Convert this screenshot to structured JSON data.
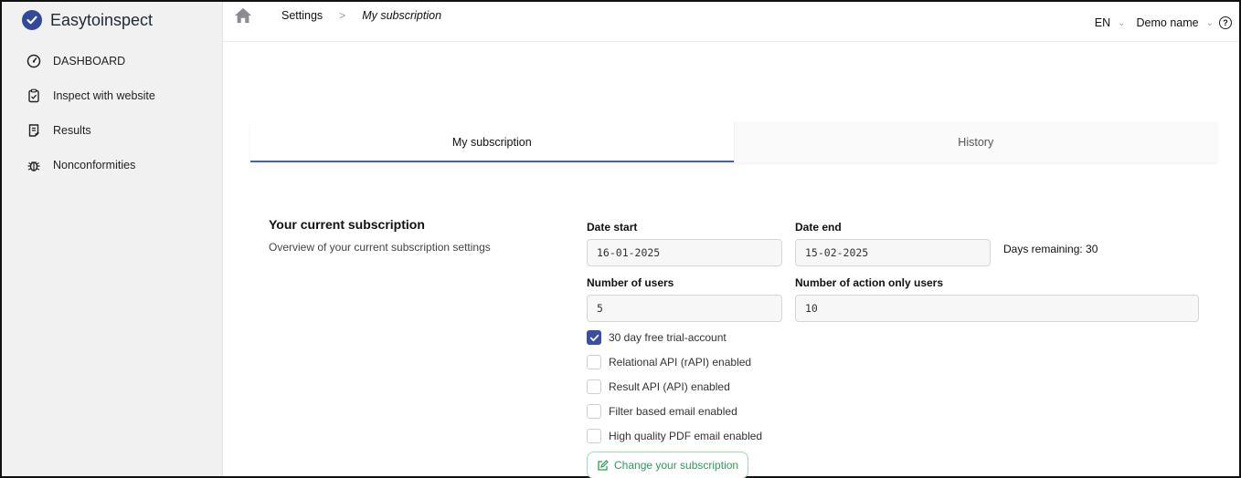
{
  "app": {
    "name": "Easytoinspect"
  },
  "sidebar": {
    "items": [
      {
        "label": "DASHBOARD",
        "icon": "dashboard-gauge-icon"
      },
      {
        "label": "Inspect with website",
        "icon": "clipboard-check-icon"
      },
      {
        "label": "Results",
        "icon": "document-list-icon"
      },
      {
        "label": "Nonconformities",
        "icon": "bug-icon"
      }
    ]
  },
  "topbar": {
    "breadcrumb_root": "Settings",
    "breadcrumb_current": "My subscription",
    "language": "EN",
    "user": "Demo name"
  },
  "tabs": [
    {
      "label": "My subscription",
      "active": true
    },
    {
      "label": "History",
      "active": false
    }
  ],
  "subscription": {
    "title": "Your current subscription",
    "description": "Overview of your current subscription settings",
    "date_start_label": "Date start",
    "date_start_value": "16-01-2025",
    "date_end_label": "Date end",
    "date_end_value": "15-02-2025",
    "days_remaining": "Days remaining: 30",
    "users_label": "Number of users",
    "users_value": "5",
    "action_users_label": "Number of action only users",
    "action_users_value": "10",
    "options": [
      {
        "label": "30 day free trial-account",
        "checked": true
      },
      {
        "label": "Relational API (rAPI) enabled",
        "checked": false
      },
      {
        "label": "Result API (API) enabled",
        "checked": false
      },
      {
        "label": "Filter based email enabled",
        "checked": false
      },
      {
        "label": "High quality PDF email enabled",
        "checked": false
      }
    ],
    "change_button": "Change your subscription"
  },
  "colors": {
    "accent": "#3a4f9f",
    "success": "#2f9a5a",
    "sidebar_bg": "#f1f1f2"
  }
}
